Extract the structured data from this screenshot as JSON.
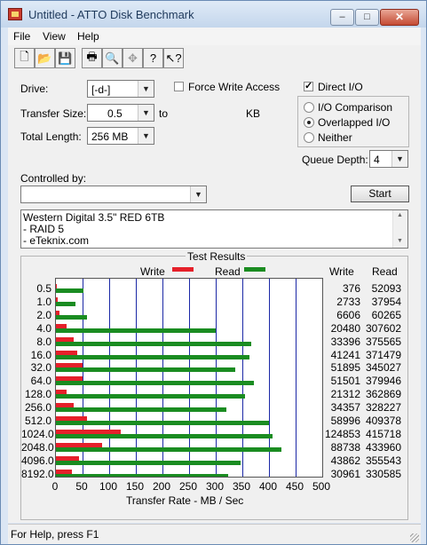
{
  "window": {
    "title": "Untitled - ATTO Disk Benchmark"
  },
  "caption_buttons": {
    "minimize": "–",
    "maximize": "□",
    "close": "✕"
  },
  "menu": [
    "File",
    "View",
    "Help"
  ],
  "toolbar": {
    "icons": [
      "new-icon",
      "open-icon",
      "save-icon",
      "print-icon",
      "print-preview-icon",
      "move-icon",
      "help-icon",
      "context-help-icon"
    ],
    "glyphs": [
      "🗋",
      "📂",
      "💾",
      "🖶",
      "🔍",
      "✥",
      "?",
      "↖?"
    ]
  },
  "form": {
    "drive_label": "Drive:",
    "drive_value": "[-d-]",
    "force_write_label": "Force Write Access",
    "force_write_checked": false,
    "direct_io_label": "Direct I/O",
    "direct_io_checked": true,
    "transfer_size_label": "Transfer Size:",
    "transfer_size_from": "0.5",
    "to_label": "to",
    "kb_label": "KB",
    "total_length_label": "Total Length:",
    "total_length_value": "256 MB",
    "io_options": [
      "I/O Comparison",
      "Overlapped I/O",
      "Neither"
    ],
    "io_selected": "Overlapped I/O",
    "queue_depth_label": "Queue Depth:",
    "queue_depth_value": "4",
    "controlled_by_label": "Controlled by:",
    "controlled_by_value": "",
    "start_label": "Start",
    "description_lines": [
      "Western Digital 3.5\" RED 6TB",
      "- RAID 5",
      "- eTeknix.com"
    ]
  },
  "results": {
    "group_title": "Test Results",
    "legend_write": "Write",
    "legend_read": "Read",
    "col_write": "Write",
    "col_read": "Read",
    "xaxis_title": "Transfer Rate - MB / Sec",
    "write_color": "#e5202a",
    "read_color": "#1a8c21"
  },
  "chart_data": {
    "type": "bar",
    "orientation": "horizontal",
    "categories": [
      "0.5",
      "1.0",
      "2.0",
      "4.0",
      "8.0",
      "16.0",
      "32.0",
      "64.0",
      "128.0",
      "256.0",
      "512.0",
      "1024.0",
      "2048.0",
      "4096.0",
      "8192.0"
    ],
    "series": [
      {
        "name": "Write",
        "values": [
          376,
          2733,
          6606,
          20480,
          33396,
          41241,
          51895,
          51501,
          21312,
          34357,
          58996,
          124853,
          88738,
          43862,
          30961
        ]
      },
      {
        "name": "Read",
        "values": [
          52093,
          37954,
          60265,
          307602,
          375565,
          371479,
          345027,
          379946,
          362869,
          328227,
          409378,
          415718,
          433960,
          355543,
          330585
        ]
      }
    ],
    "xlabel": "Transfer Rate - MB / Sec",
    "xlim": [
      0,
      500
    ],
    "xticks": [
      "0",
      "50",
      "100",
      "150",
      "200",
      "250",
      "300",
      "350",
      "400",
      "450",
      "500"
    ],
    "grid": true,
    "legend": "top"
  },
  "status": {
    "text": "For Help, press F1"
  }
}
